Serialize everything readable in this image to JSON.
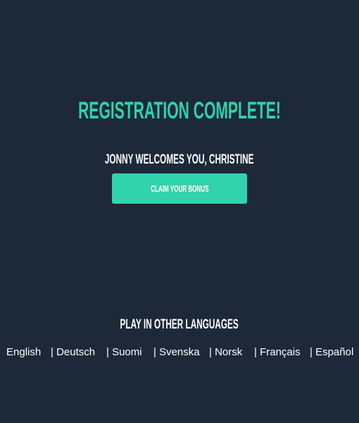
{
  "title": "REGISTRATION COMPLETE!",
  "welcome": "JONNY WELCOMES YOU, CHRISTINE",
  "claim_button": "CLAIM YOUR BONUS",
  "languages_title": "PLAY IN OTHER LANGUAGES",
  "languages": [
    "English",
    "| Deutsch",
    "| Suomi",
    "| Svenska",
    "| Norsk",
    "| Français",
    "| Español"
  ],
  "colors": {
    "background": "#1d2939",
    "accent": "#2ed3aa",
    "button": "#31d3ac"
  }
}
